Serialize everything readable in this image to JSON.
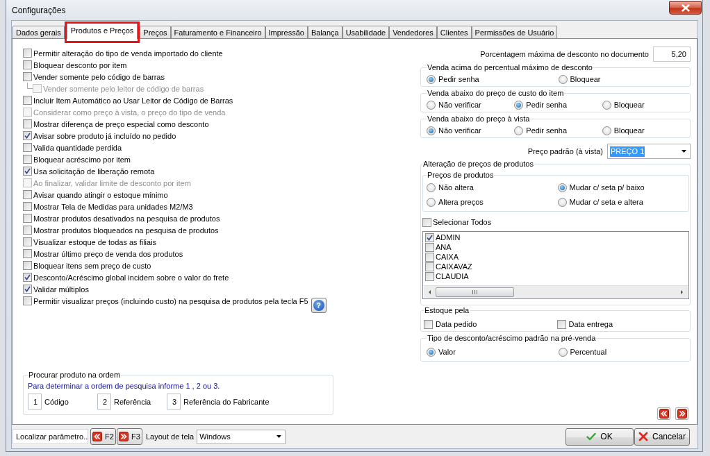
{
  "window": {
    "title": "Configurações"
  },
  "tabs": [
    {
      "label": "Dados gerais",
      "selected": false,
      "highlighted": false
    },
    {
      "label": "Produtos e Preços",
      "selected": true,
      "highlighted": true
    },
    {
      "label": "Preços",
      "selected": false,
      "highlighted": false
    },
    {
      "label": "Faturamento e Financeiro",
      "selected": false,
      "highlighted": false
    },
    {
      "label": "Impressão",
      "selected": false,
      "highlighted": false
    },
    {
      "label": "Balança",
      "selected": false,
      "highlighted": false
    },
    {
      "label": "Usabilidade",
      "selected": false,
      "highlighted": false
    },
    {
      "label": "Vendedores",
      "selected": false,
      "highlighted": false
    },
    {
      "label": "Clientes",
      "selected": false,
      "highlighted": false
    },
    {
      "label": "Permissões de Usuário",
      "selected": false,
      "highlighted": false
    }
  ],
  "options": [
    {
      "label": "Permitir alteração do tipo de venda importado do cliente",
      "checked": false,
      "disabled": false
    },
    {
      "label": "Bloquear desconto por item",
      "checked": false,
      "disabled": false
    },
    {
      "label": "Vender somente pelo código de barras",
      "checked": false,
      "disabled": false,
      "children": [
        {
          "label": "Vender somente pelo leitor de código de barras",
          "checked": false,
          "disabled": true
        }
      ]
    },
    {
      "label": "Incluir Item Automático ao Usar Leitor de Código de Barras",
      "checked": false,
      "disabled": false
    },
    {
      "label": "Considerar como preço à vista, o preço do tipo de venda",
      "checked": false,
      "disabled": true
    },
    {
      "label": "Mostrar diferença de preço especial como desconto",
      "checked": false,
      "disabled": false
    },
    {
      "label": "Avisar sobre produto já incluído no pedido",
      "checked": true,
      "disabled": false
    },
    {
      "label": "Valida quantidade perdida",
      "checked": false,
      "disabled": false
    },
    {
      "label": "Bloquear acréscimo por item",
      "checked": false,
      "disabled": false
    },
    {
      "label": "Usa solicitação de liberação remota",
      "checked": true,
      "disabled": false
    },
    {
      "label": "Ao finalizar, validar limite de desconto por item",
      "checked": false,
      "disabled": true
    },
    {
      "label": "Avisar quando atingir o estoque mínimo",
      "checked": false,
      "disabled": false
    },
    {
      "label": "Mostrar Tela de Medidas para unidades M2/M3",
      "checked": false,
      "disabled": false
    },
    {
      "label": "Mostrar produtos desativados na pesquisa de produtos",
      "checked": false,
      "disabled": false
    },
    {
      "label": "Mostrar produtos bloqueados na pesquisa de produtos",
      "checked": false,
      "disabled": false
    },
    {
      "label": "Visualizar estoque de todas as filiais",
      "checked": false,
      "disabled": false
    },
    {
      "label": "Mostrar último preço de venda dos produtos",
      "checked": false,
      "disabled": false
    },
    {
      "label": "Bloquear itens sem preço de custo",
      "checked": false,
      "disabled": false
    },
    {
      "label": "Desconto/Acréscimo global incidem sobre o valor do frete",
      "checked": true,
      "disabled": false
    },
    {
      "label": "Validar múltiplos",
      "checked": true,
      "disabled": false
    },
    {
      "label": "Permitir visualizar preços (incluindo custo) na pesquisa de produtos pela tecla F5",
      "checked": false,
      "disabled": false,
      "help": "?"
    }
  ],
  "search_order": {
    "title": "Procurar produto na ordem",
    "hint": "Para determinar a ordem de pesquisa informe 1 , 2 ou 3.",
    "fields": [
      {
        "value": "1",
        "label": "Código"
      },
      {
        "value": "2",
        "label": "Referência"
      },
      {
        "value": "3",
        "label": "Referência do Fabricante"
      }
    ]
  },
  "max_discount": {
    "label": "Porcentagem máxima de desconto no documento",
    "value": "5,20"
  },
  "radio_groups": [
    {
      "title": "Venda acima do percentual máximo de desconto",
      "options": [
        {
          "label": "Pedir senha",
          "selected": true
        },
        {
          "label": "Bloquear",
          "selected": false
        }
      ]
    },
    {
      "title": "Venda abaixo do preço de custo do item",
      "options": [
        {
          "label": "Não verificar",
          "selected": false
        },
        {
          "label": "Pedir senha",
          "selected": true
        },
        {
          "label": "Bloquear",
          "selected": false
        }
      ]
    },
    {
      "title": "Venda abaixo do preço à vista",
      "options": [
        {
          "label": "Não verificar",
          "selected": true
        },
        {
          "label": "Pedir senha",
          "selected": false
        },
        {
          "label": "Bloquear",
          "selected": false
        }
      ]
    }
  ],
  "default_price": {
    "label": "Preço padrão (à vista)",
    "value": "PREÇO 1",
    "focused": true
  },
  "price_change": {
    "title": "Alteração de preços de produtos",
    "product_prices": {
      "title": "Preços de produtos",
      "options": [
        {
          "label": "Não altera",
          "selected": false
        },
        {
          "label": "Mudar c/ seta p/ baixo",
          "selected": true
        },
        {
          "label": "Altera preços",
          "selected": false
        },
        {
          "label": "Mudar c/ seta e altera",
          "selected": false
        }
      ]
    },
    "select_all": {
      "label": "Selecionar Todos",
      "checked": false
    },
    "users": [
      {
        "name": "ADMIN",
        "checked": true
      },
      {
        "name": "ANA",
        "checked": false
      },
      {
        "name": "CAIXA",
        "checked": false
      },
      {
        "name": "CAIXAVAZ",
        "checked": false
      },
      {
        "name": "CLAUDIA",
        "checked": false
      }
    ]
  },
  "stock_by": {
    "title": "Estoque pela",
    "options": [
      {
        "label": "Data pedido",
        "checked": false
      },
      {
        "label": "Data entrega",
        "checked": false
      }
    ]
  },
  "discount_type": {
    "title": "Tipo de desconto/acréscimo padrão na pré-venda",
    "options": [
      {
        "label": "Valor",
        "selected": true
      },
      {
        "label": "Percentual",
        "selected": false
      }
    ]
  },
  "footer": {
    "search_button": "Localizar parâmetro..",
    "prev_button": "F2",
    "next_button": "F3",
    "layout_label": "Layout de tela",
    "layout_value": "Windows",
    "ok_button": "OK",
    "cancel_button": "Cancelar"
  }
}
